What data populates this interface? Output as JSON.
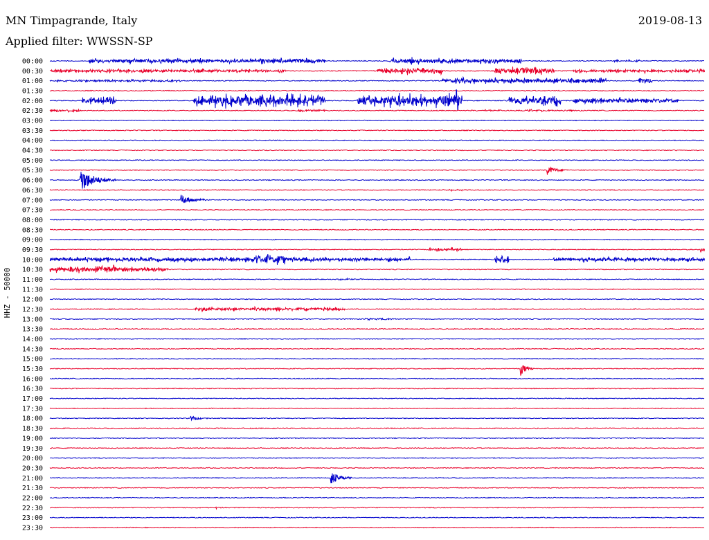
{
  "header": {
    "station": "MN Timpagrande, Italy",
    "filter": "Applied filter: WWSSN-SP",
    "date": "2019-08-13"
  },
  "colors": {
    "even_trace": "#0000cc",
    "odd_trace": "#e8002a"
  },
  "chart_data": {
    "type": "line",
    "title": "MN Timpagrande, Italy",
    "subtitle": "Applied filter: WWSSN-SP",
    "date": "2019-08-13",
    "ylabel": "HHZ - 50000",
    "xlabel": "",
    "grid": false,
    "legend": "none",
    "row_labels": [
      "00:00",
      "00:30",
      "01:00",
      "01:30",
      "02:00",
      "02:30",
      "03:00",
      "03:30",
      "04:00",
      "04:30",
      "05:00",
      "05:30",
      "06:00",
      "06:30",
      "07:00",
      "07:30",
      "08:00",
      "08:30",
      "09:00",
      "09:30",
      "10:00",
      "10:30",
      "11:00",
      "11:30",
      "12:00",
      "12:30",
      "13:00",
      "13:30",
      "14:00",
      "14:30",
      "15:00",
      "15:30",
      "16:00",
      "16:30",
      "17:00",
      "17:30",
      "18:00",
      "18:30",
      "19:00",
      "19:30",
      "20:00",
      "20:30",
      "21:00",
      "21:30",
      "22:00",
      "22:30",
      "23:00",
      "23:30"
    ],
    "row_colors": [
      "blue",
      "red"
    ],
    "events": [
      {
        "row": 0,
        "start": 0.06,
        "end": 0.42,
        "amp": 5,
        "kind": "burst"
      },
      {
        "row": 0,
        "start": 0.32,
        "end": 0.4,
        "amp": 6,
        "kind": "burst"
      },
      {
        "row": 0,
        "start": 0.52,
        "end": 0.72,
        "amp": 6,
        "kind": "burst"
      },
      {
        "row": 0,
        "start": 0.86,
        "end": 0.9,
        "amp": 3,
        "kind": "burst"
      },
      {
        "row": 1,
        "start": 0.0,
        "end": 0.36,
        "amp": 4,
        "kind": "burst"
      },
      {
        "row": 1,
        "start": 0.5,
        "end": 0.6,
        "amp": 7,
        "kind": "burst"
      },
      {
        "row": 1,
        "start": 0.68,
        "end": 0.77,
        "amp": 8,
        "kind": "burst"
      },
      {
        "row": 1,
        "start": 0.8,
        "end": 1.0,
        "amp": 4,
        "kind": "burst"
      },
      {
        "row": 2,
        "start": 0.0,
        "end": 0.2,
        "amp": 3,
        "kind": "burst"
      },
      {
        "row": 2,
        "start": 0.6,
        "end": 0.85,
        "amp": 6,
        "kind": "burst"
      },
      {
        "row": 2,
        "start": 0.9,
        "end": 0.92,
        "amp": 8,
        "kind": "burst"
      },
      {
        "row": 4,
        "start": 0.05,
        "end": 0.1,
        "amp": 8,
        "kind": "burst"
      },
      {
        "row": 4,
        "start": 0.22,
        "end": 0.42,
        "amp": 15,
        "kind": "burst"
      },
      {
        "row": 4,
        "start": 0.47,
        "end": 0.62,
        "amp": 13,
        "kind": "burst"
      },
      {
        "row": 4,
        "start": 0.59,
        "end": 0.63,
        "amp": 18,
        "kind": "burst"
      },
      {
        "row": 4,
        "start": 0.7,
        "end": 0.78,
        "amp": 12,
        "kind": "burst"
      },
      {
        "row": 4,
        "start": 0.8,
        "end": 0.96,
        "amp": 6,
        "kind": "burst"
      },
      {
        "row": 5,
        "start": 0.0,
        "end": 0.05,
        "amp": 3,
        "kind": "burst"
      },
      {
        "row": 5,
        "start": 0.38,
        "end": 0.42,
        "amp": 3,
        "kind": "burst"
      },
      {
        "row": 5,
        "start": 0.64,
        "end": 0.82,
        "amp": 2,
        "kind": "burst"
      },
      {
        "row": 11,
        "start": 0.76,
        "end": 0.79,
        "amp": 6,
        "kind": "quake"
      },
      {
        "row": 12,
        "start": 0.045,
        "end": 0.1,
        "amp": 18,
        "kind": "quake"
      },
      {
        "row": 13,
        "start": 0.61,
        "end": 0.63,
        "amp": 2,
        "kind": "burst"
      },
      {
        "row": 14,
        "start": 0.2,
        "end": 0.24,
        "amp": 7,
        "kind": "quake"
      },
      {
        "row": 19,
        "start": 0.58,
        "end": 0.63,
        "amp": 4,
        "kind": "burst"
      },
      {
        "row": 19,
        "start": 0.995,
        "end": 1.0,
        "amp": 6,
        "kind": "burst"
      },
      {
        "row": 20,
        "start": 0.0,
        "end": 0.55,
        "amp": 5,
        "kind": "burst"
      },
      {
        "row": 20,
        "start": 0.31,
        "end": 0.36,
        "amp": 12,
        "kind": "burst"
      },
      {
        "row": 20,
        "start": 0.68,
        "end": 0.7,
        "amp": 11,
        "kind": "burst"
      },
      {
        "row": 20,
        "start": 0.77,
        "end": 1.0,
        "amp": 5,
        "kind": "burst"
      },
      {
        "row": 21,
        "start": 0.0,
        "end": 0.18,
        "amp": 6,
        "kind": "burst"
      },
      {
        "row": 21,
        "start": 0.07,
        "end": 0.1,
        "amp": 9,
        "kind": "burst"
      },
      {
        "row": 22,
        "start": 0.44,
        "end": 0.48,
        "amp": 2,
        "kind": "burst"
      },
      {
        "row": 25,
        "start": 0.22,
        "end": 0.45,
        "amp": 4,
        "kind": "burst"
      },
      {
        "row": 26,
        "start": 0.48,
        "end": 0.53,
        "amp": 2,
        "kind": "burst"
      },
      {
        "row": 31,
        "start": 0.72,
        "end": 0.74,
        "amp": 9,
        "kind": "quake"
      },
      {
        "row": 36,
        "start": 0.215,
        "end": 0.24,
        "amp": 3,
        "kind": "quake"
      },
      {
        "row": 42,
        "start": 0.43,
        "end": 0.46,
        "amp": 10,
        "kind": "quake"
      },
      {
        "row": 45,
        "start": 0.25,
        "end": 0.27,
        "amp": 2,
        "kind": "burst"
      }
    ]
  }
}
